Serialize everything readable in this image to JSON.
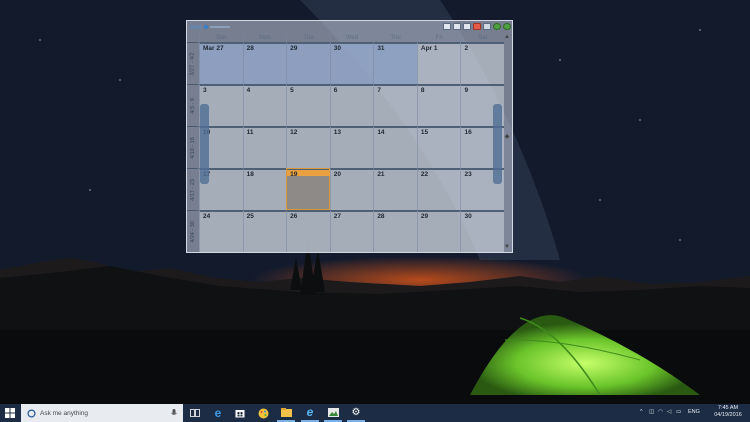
{
  "calendar": {
    "weekdays": [
      "Sun",
      "Mon",
      "Tue",
      "Wed",
      "Thu",
      "Fri",
      "Sat"
    ],
    "weeks": [
      {
        "label": "3/27 - 4/2",
        "days": [
          "Mar 27",
          "28",
          "29",
          "30",
          "31",
          "Apr 1",
          "2"
        ]
      },
      {
        "label": "4/3 - 9",
        "days": [
          "3",
          "4",
          "5",
          "6",
          "7",
          "8",
          "9"
        ]
      },
      {
        "label": "4/10 - 16",
        "days": [
          "10",
          "11",
          "12",
          "13",
          "14",
          "15",
          "16"
        ]
      },
      {
        "label": "4/17 - 23",
        "days": [
          "17",
          "18",
          "19",
          "20",
          "21",
          "22",
          "23"
        ]
      },
      {
        "label": "4/24 - 30",
        "days": [
          "24",
          "25",
          "26",
          "27",
          "28",
          "29",
          "30"
        ]
      }
    ],
    "today_label": "19"
  },
  "taskbar": {
    "search_placeholder": "Ask me anything",
    "icons": [
      "windows-start-icon",
      "cortana-icon",
      "microphone-icon",
      "task-view-icon",
      "edge-icon",
      "store-icon",
      "paint-icon",
      "file-explorer-icon",
      "internet-explorer-icon",
      "photos-icon",
      "settings-icon"
    ],
    "language": "ENG",
    "time": "7:45 AM",
    "date": "04/19/2016"
  },
  "colors": {
    "taskbar": "#1c2c44",
    "today_accent": "#e8a040",
    "prev_month_cell": "#96aacd",
    "tent": "#7fd63a"
  }
}
